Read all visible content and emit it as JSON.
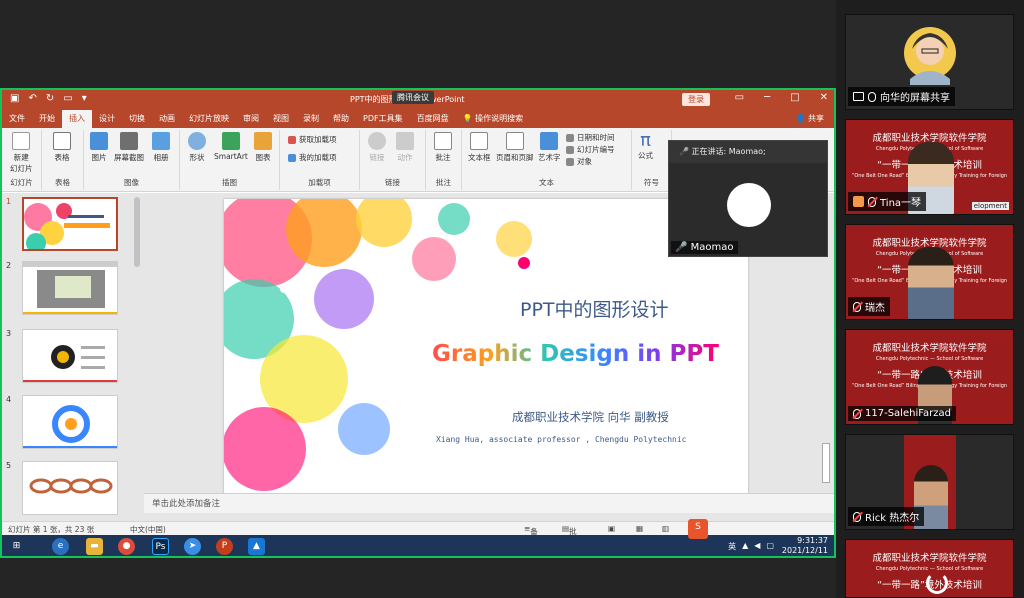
{
  "powerpoint": {
    "title": "PPT中的图形设计 - PowerPoint",
    "meeting_badge": "腾讯会议",
    "login_label": "登录",
    "tabs": [
      "文件",
      "开始",
      "插入",
      "设计",
      "切换",
      "动画",
      "幻灯片放映",
      "审阅",
      "视图",
      "录制",
      "帮助",
      "PDF工具集",
      "百度网盘",
      "操作说明搜索"
    ],
    "active_tab": "插入",
    "share_label": "共享",
    "ribbon": {
      "new_slide": "新建\n幻灯片",
      "table": "表格",
      "picture": "图片",
      "screenshot": "屏幕截图",
      "album": "相册",
      "shape": "形状",
      "smartart": "SmartArt",
      "chart": "图表",
      "get_addins": "获取加载项",
      "my_addins": "我的加载项",
      "link": "链接",
      "action": "动作",
      "comment": "批注",
      "textbox": "文本框",
      "header_footer": "页眉和页脚",
      "wordart": "艺术字",
      "date_time": "日期和时间",
      "slide_number": "幻灯片编号",
      "object": "对象",
      "formula": "公式",
      "groups": {
        "slides": "幻灯片",
        "tables": "表格",
        "images": "图像",
        "illustrations": "插图",
        "addins": "加载项",
        "links": "链接",
        "comments": "批注",
        "text": "文本",
        "symbols": "符号"
      }
    },
    "thumbnails": [
      "1",
      "2",
      "3",
      "4",
      "5"
    ],
    "slide": {
      "title_cn": "PPT中的图形设计",
      "title_en": "Graphic Design in PPT",
      "author_cn": "成都职业技术学院  向华  副教授",
      "author_en": "Xiang Hua, associate professor , Chengdu Polytechnic"
    },
    "notes_placeholder": "单击此处添加备注",
    "status": {
      "slide_count": "幻灯片 第 1 张，共 23 张",
      "language": "中文(中国)",
      "notes": "备注",
      "comments": "批注"
    }
  },
  "taskbar": {
    "time": "9:31:37",
    "date": "2021/12/11",
    "ime": "英"
  },
  "speaker": {
    "header": "正在讲话: Maomao;",
    "name": "Maomao"
  },
  "participants": [
    {
      "name": "向华的屏幕共享",
      "type": "share"
    },
    {
      "name": "Tina一琴",
      "muted": true
    },
    {
      "name": "瑞杰",
      "muted": true
    },
    {
      "name": "117-SalehiFarzad",
      "muted": true
    },
    {
      "name": "Rick 热杰尔",
      "muted": true
    }
  ],
  "banner": {
    "cn": "成都职业技术学院软件学院",
    "en": "Chengdu Polytechnic — School of Software",
    "cn2": "“一带一路”境外技术培训",
    "en2": "“One Belt One Road” Bilingual Technology Training for Foreign",
    "tag": "elopment"
  },
  "colors": {
    "ppt_accent": "#b7472a",
    "share_border": "#12c45a",
    "banner_red": "#9b1c1c"
  }
}
